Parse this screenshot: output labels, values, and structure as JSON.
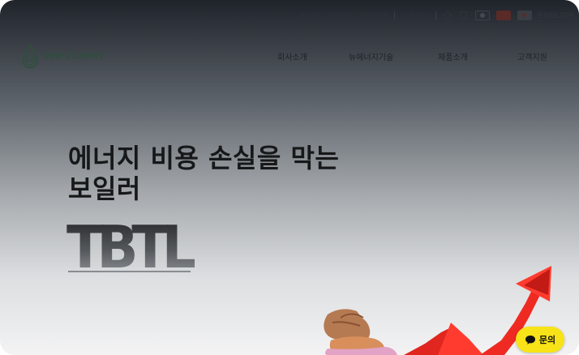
{
  "topbar": {
    "links": [
      "로그인",
      "회원가입",
      "사이트맵",
      "고객센터"
    ],
    "lang_label": "ENGLISH"
  },
  "logo": {
    "text": "NEW ENERGY",
    "badge": "NE"
  },
  "nav": {
    "items": [
      "회사소개",
      "뉴에너지기술",
      "제품소개",
      "고객지원"
    ]
  },
  "hero": {
    "title_line1": "에너지 비용 손실을 막는",
    "title_line2": "보일러",
    "brand": "TBTL"
  },
  "chat": {
    "label": "문의"
  },
  "colors": {
    "chat_bg": "#f7e318",
    "arrow_red": "#e0261f",
    "logo_green": "#2d4f3c"
  }
}
